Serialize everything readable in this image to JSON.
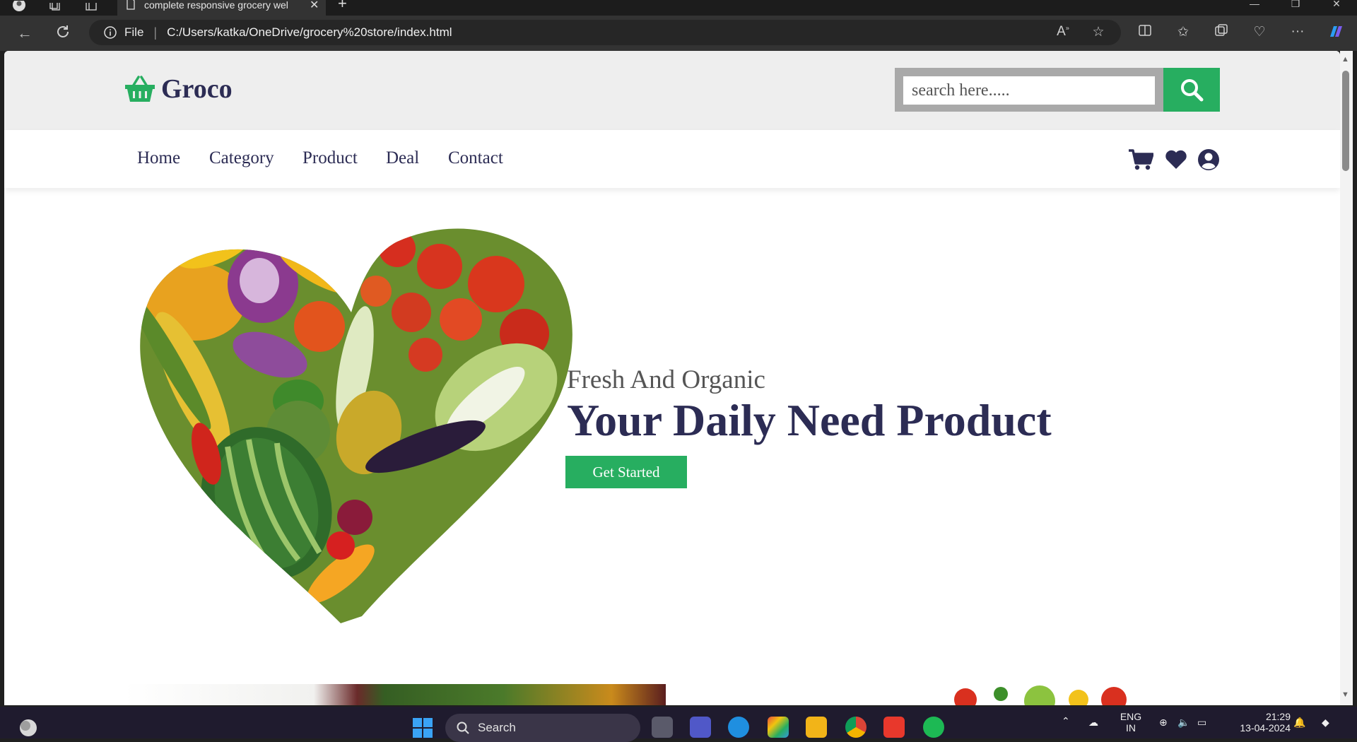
{
  "browser": {
    "tab_title": "complete responsive grocery wel",
    "new_tab_label": "+",
    "url_scheme_label": "File",
    "url": "C:/Users/katka/OneDrive/grocery%20store/index.html"
  },
  "site": {
    "logo_text": "Groco",
    "search_placeholder": "search here.....",
    "nav": [
      "Home",
      "Category",
      "Product",
      "Deal",
      "Contact"
    ],
    "hero": {
      "subtitle": "Fresh And Organic",
      "title": "Your Daily Need Product",
      "button": "Get Started"
    },
    "colors": {
      "brand_green": "#27ae60",
      "heading_navy": "#2c2c54",
      "header_gray": "#eeeeee"
    }
  },
  "taskbar": {
    "search_label": "Search",
    "lang_1": "ENG",
    "lang_2": "IN",
    "time": "21:29",
    "date": "13-04-2024"
  }
}
